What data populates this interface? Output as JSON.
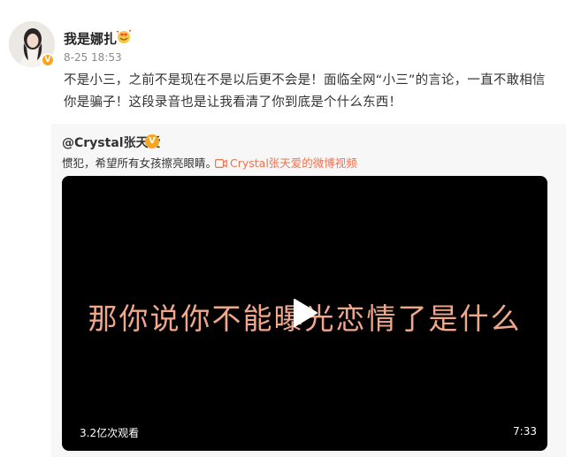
{
  "post": {
    "username": "我是娜扎",
    "username_emoji": "smiling-face-with-hearts-icon",
    "timestamp": "8-25 18:53",
    "content": "不是小三，之前不是现在不是以后更不会是！面临全网“小三”的言论，一直不敢相信你是骗子！这段录音也是让我看清了你到底是个什么东西！"
  },
  "quoted": {
    "author": "@Crystal张天爱",
    "text": "惯犯，希望所有女孩擦亮眼睛。",
    "video_link": "Crystal张天爱的微博视频",
    "video": {
      "subtitle": "那你说你不能曝光恋情了是什么",
      "views": "3.2亿次观看",
      "duration": "7:33"
    }
  },
  "colors": {
    "accent_link": "#eb7350",
    "verify_badge": "#f5a623",
    "subtitle": "#f0a78a"
  }
}
